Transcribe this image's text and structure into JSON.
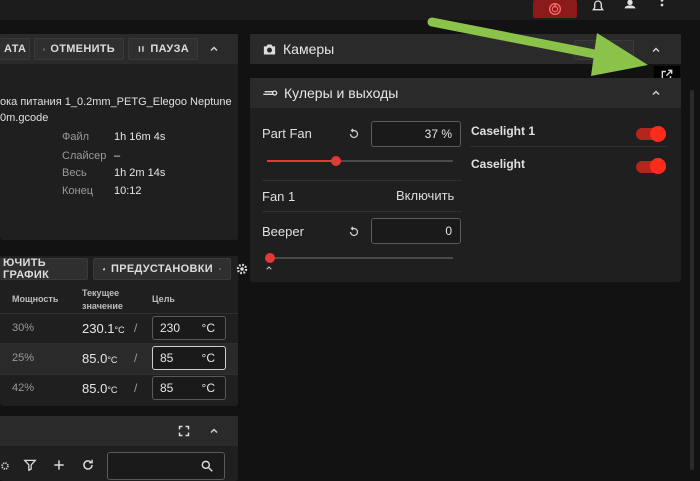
{
  "topbar": {
    "icons": [
      "emergency-stop-icon",
      "bell-icon",
      "account-icon",
      "more-vert-icon"
    ]
  },
  "job": {
    "btn_partial": "АТА",
    "btn_cancel": "ОТМЕНИТЬ",
    "btn_pause": "ПАУЗА",
    "filename_line1": "ока питания 1_0.2mm_PETG_Elegoo Neptune",
    "filename_line2": "0m.gcode",
    "stats": [
      {
        "label": "Файл",
        "value": "1h 16m 4s"
      },
      {
        "label": "Слайсер",
        "value": "–"
      },
      {
        "label": "Весь",
        "value": "1h 2m 14s"
      },
      {
        "label": "Конец",
        "value": "10:12"
      }
    ]
  },
  "thermals": {
    "btn_graph": "ЮЧИТЬ ГРАФИК",
    "btn_presets": "ПРЕДУСТАНОВКИ",
    "headers": {
      "power": "Мощность",
      "current_1": "Текущее",
      "current_2": "значение",
      "target": "Цель"
    },
    "rows": [
      {
        "power": "30%",
        "current": "230.1",
        "unit": "°C",
        "target": "230",
        "target_unit": "°C"
      },
      {
        "power": "25%",
        "current": "85.0",
        "unit": "°C",
        "target": "85",
        "target_unit": "°C"
      },
      {
        "power": "42%",
        "current": "85.0",
        "unit": "°C",
        "target": "85",
        "target_unit": "°C"
      }
    ],
    "slash": "/"
  },
  "cameras": {
    "title": "Камеры"
  },
  "fans": {
    "title": "Кулеры и выходы",
    "part_fan": {
      "label": "Part Fan",
      "value": "37 %",
      "level": 0.37
    },
    "fan1": {
      "label": "Fan 1",
      "action": "Включить"
    },
    "beeper": {
      "label": "Beeper",
      "value": "0",
      "level": 0
    },
    "outputs": [
      {
        "label": "Caselight 1",
        "on": true
      },
      {
        "label": "Caselight",
        "on": true
      }
    ]
  },
  "annotation": {
    "color": "#8bc34a"
  }
}
